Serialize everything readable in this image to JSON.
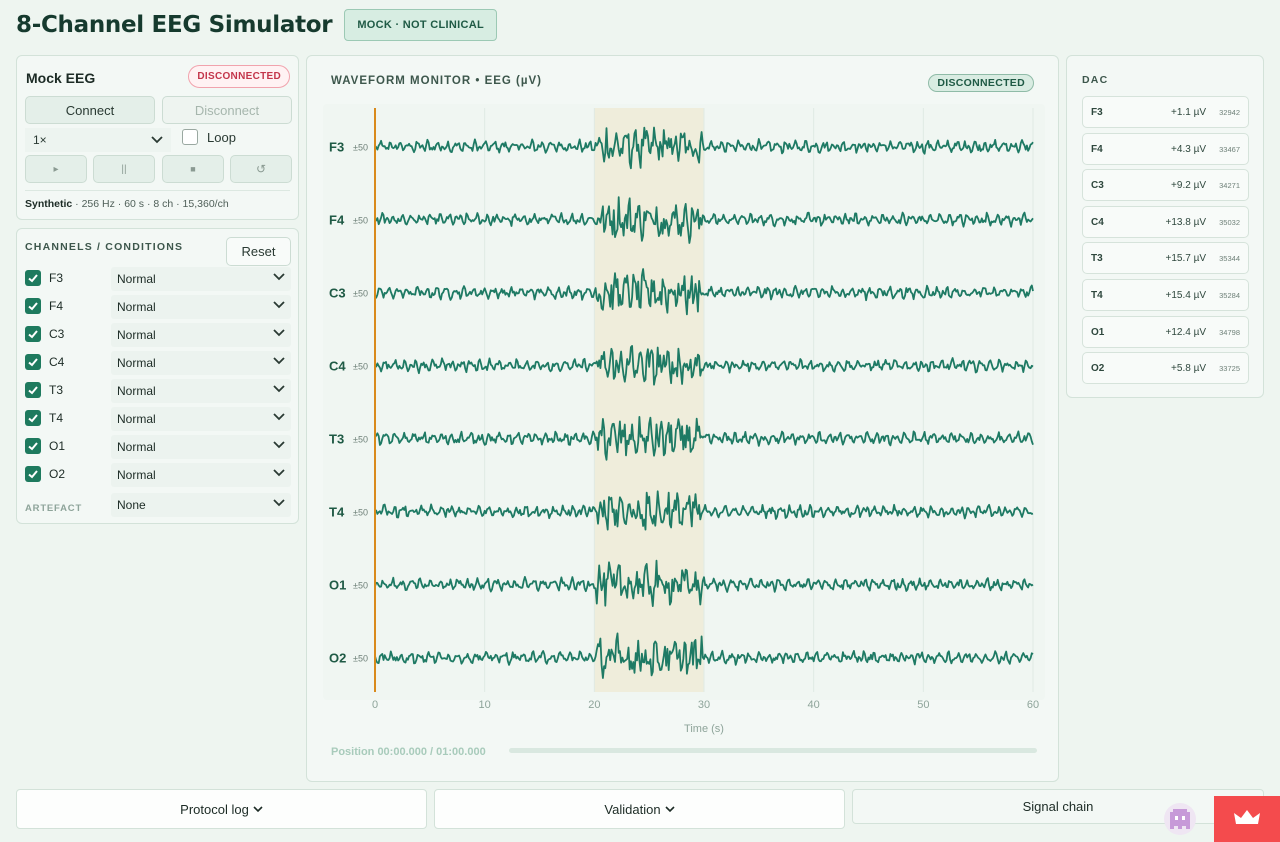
{
  "header": {
    "title": "8-Channel EEG Simulator",
    "badge": "MOCK · NOT CLINICAL"
  },
  "device": {
    "name": "Mock EEG",
    "status": "DISCONNECTED",
    "connect_label": "Connect",
    "disconnect_label": "Disconnect",
    "speed": "1×",
    "loop_label": "Loop",
    "loop_checked": false,
    "transport": {
      "play": "▸",
      "pause": "||",
      "stop": "■",
      "reset": "↺"
    },
    "source_label": "Synthetic",
    "source_meta": " · 256 Hz · 60 s · 8 ch · 15,360/ch"
  },
  "channels_panel": {
    "title": "CHANNELS / CONDITIONS",
    "reset_label": "Reset",
    "channels": [
      {
        "name": "F3",
        "checked": true,
        "condition": "Normal"
      },
      {
        "name": "F4",
        "checked": true,
        "condition": "Normal"
      },
      {
        "name": "C3",
        "checked": true,
        "condition": "Normal"
      },
      {
        "name": "C4",
        "checked": true,
        "condition": "Normal"
      },
      {
        "name": "T3",
        "checked": true,
        "condition": "Normal"
      },
      {
        "name": "T4",
        "checked": true,
        "condition": "Normal"
      },
      {
        "name": "O1",
        "checked": true,
        "condition": "Normal"
      },
      {
        "name": "O2",
        "checked": true,
        "condition": "Normal"
      }
    ],
    "artefact_label": "ARTEFACT",
    "artefact_value": "None"
  },
  "waveform": {
    "title": "WAVEFORM MONITOR • EEG (µV)",
    "status": "DISCONNECTED",
    "scale_label": "±50",
    "xlabel": "Time (s)",
    "position_label": "Position 00:00.000 / 01:00.000",
    "position_fraction": 0.0
  },
  "chart_data": {
    "type": "line",
    "xlabel": "Time (s)",
    "xlim": [
      0,
      60
    ],
    "x_ticks": [
      0,
      10,
      20,
      30,
      40,
      50,
      60
    ],
    "series": [
      {
        "name": "F3"
      },
      {
        "name": "F4"
      },
      {
        "name": "C3"
      },
      {
        "name": "C4"
      },
      {
        "name": "T3"
      },
      {
        "name": "T4"
      },
      {
        "name": "O1"
      },
      {
        "name": "O2"
      }
    ],
    "channel_range_uV": [
      -50,
      50
    ],
    "highlight_window_s": [
      20,
      30
    ],
    "cursor_s": 0,
    "grid": true
  },
  "dac": {
    "title": "DAC",
    "rows": [
      {
        "ch": "F3",
        "value": "+1.1 µV",
        "code": "32942"
      },
      {
        "ch": "F4",
        "value": "+4.3 µV",
        "code": "33467"
      },
      {
        "ch": "C3",
        "value": "+9.2 µV",
        "code": "34271"
      },
      {
        "ch": "C4",
        "value": "+13.8 µV",
        "code": "35032"
      },
      {
        "ch": "T3",
        "value": "+15.7 µV",
        "code": "35344"
      },
      {
        "ch": "T4",
        "value": "+15.4 µV",
        "code": "35284"
      },
      {
        "ch": "O1",
        "value": "+12.4 µV",
        "code": "34798"
      },
      {
        "ch": "O2",
        "value": "+5.8 µV",
        "code": "33725"
      }
    ]
  },
  "bottom": {
    "protocol_log": "Protocol log",
    "validation": "Validation",
    "signal_chain": "Signal chain"
  },
  "colors": {
    "trace": "#1e7a64",
    "cursor": "#d98a1c",
    "highlight": "#efeddb",
    "accent": "#1e7a5e",
    "danger": "#c3364b"
  }
}
